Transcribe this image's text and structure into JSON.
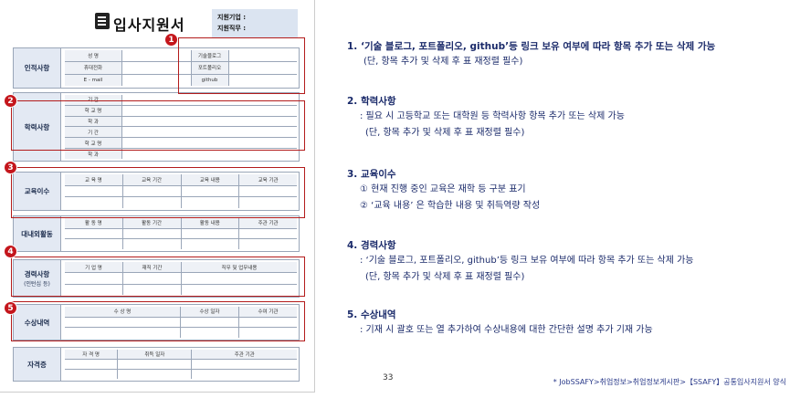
{
  "form": {
    "title": "입사지원서",
    "apply_company": "지원기업 :",
    "apply_role": "지원직무 :",
    "personal": {
      "label": "인적사항",
      "rows": [
        [
          "성     명",
          "",
          "기술블로그",
          ""
        ],
        [
          "휴대전화",
          "",
          "포트폴리오",
          ""
        ],
        [
          "E - mail",
          "",
          "github",
          ""
        ]
      ]
    },
    "education": {
      "label": "학력사항",
      "rows": [
        [
          "기     간",
          ""
        ],
        [
          "학 교 명",
          ""
        ],
        [
          "학     과",
          ""
        ],
        [
          "기     간",
          ""
        ],
        [
          "학 교 명",
          ""
        ],
        [
          "학     과",
          ""
        ]
      ]
    },
    "training": {
      "label": "교육이수",
      "headers": [
        "교 육 명",
        "교육 기간",
        "교육 내용",
        "교육 기관"
      ]
    },
    "activities": {
      "label": "대내외활동",
      "headers": [
        "활 동 명",
        "활동 기간",
        "활동 내용",
        "주관 기관"
      ]
    },
    "career": {
      "label": "경력사항",
      "sublabel": "(인턴십 등)",
      "headers": [
        "기 업 명",
        "재직 기간",
        "직무 및 업무내용"
      ]
    },
    "awards": {
      "label": "수상내역",
      "headers": [
        "수 상 명",
        "수상 일자",
        "수여 기관"
      ]
    },
    "certs": {
      "label": "자격증",
      "headers": [
        "자 격 명",
        "취득 일자",
        "주관 기관"
      ]
    }
  },
  "badges": [
    "1",
    "2",
    "3",
    "4",
    "5"
  ],
  "notes": [
    {
      "title": "1. ‘기술 블로그, 포트폴리오, github’등 링크 보유 여부에 따라 항목 추가 또는 삭제 가능",
      "lines": [
        "(단, 항목 추가 및 삭제 후 표 재정렬 필수)"
      ]
    },
    {
      "title": "2. 학력사항",
      "lines": [
        ": 필요 시 고등학교 또는 대학원 등 학력사항 항목 추가 또는 삭제 가능",
        "(단, 항목 추가 및 삭제 후 표 재정렬 필수)"
      ]
    },
    {
      "title": "3. 교육이수",
      "lines": [
        "① 현재 진행 중인 교육은 재학 등 구분 표기",
        "② ‘교육 내용’ 은 학습한 내용 및 취득역량 작성"
      ]
    },
    {
      "title": "4. 경력사항",
      "lines": [
        ": ‘기술 블로그, 포트폴리오, github’등 링크 보유 여부에 따라 항목 추가 또는 삭제 가능",
        "(단, 항목 추가 및 삭제 후 표 재정렬 필수)"
      ]
    },
    {
      "title": "5. 수상내역",
      "lines": [
        ": 기재 시 괄호 또는 열 추가하여 수상내용에 대한 간단한 설명 추가 기재 가능"
      ]
    }
  ],
  "page_number": "33",
  "source": "* JobSSAFY>취업정보>취업정보게시판>【SSAFY】공통입사지원서 양식",
  "colors": {
    "accent_red": "#c4161c",
    "notes_text": "#1a2a6a",
    "label_bg": "#e3e9f3"
  }
}
